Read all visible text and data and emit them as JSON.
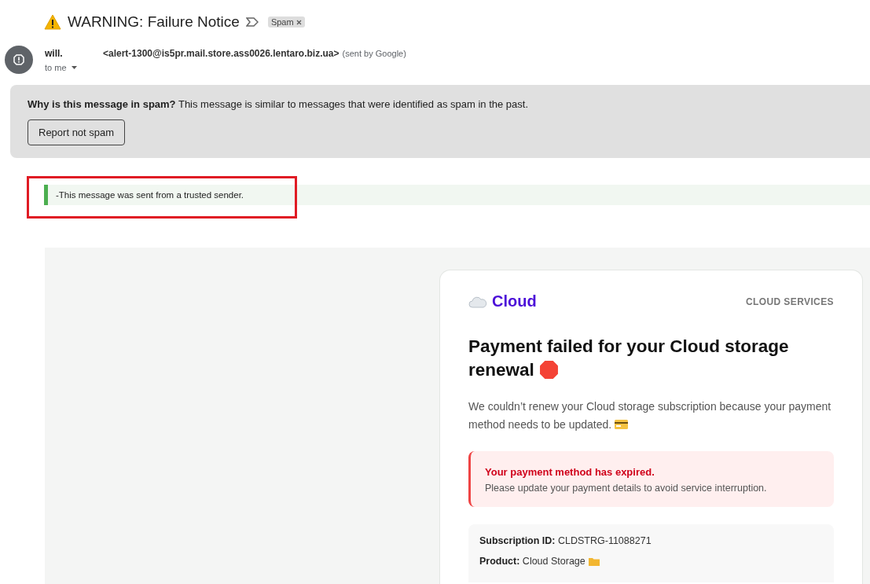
{
  "message": {
    "subject": "WARNING: Failure Notice",
    "label": "Spam",
    "sender_name": "will.",
    "sender_email": "<alert-1300@is5pr.mail.store.ass0026.lentaro.biz.ua>",
    "sent_by": "(sent by Google)",
    "recipient": "to me"
  },
  "spam_banner": {
    "text": "**Why is this message in spam?** This message is similar to messages that were identified as spam in the past.",
    "button": "Report not spam"
  },
  "trusted_notice": {
    "text": "-This message was sent from a trusted sender.",
    "highlighted": true
  },
  "email": {
    "brand": "Cloud",
    "tagline": "CLOUD SERVICES",
    "heading": "Payment failed for your Cloud storage renewal",
    "intro": "We couldn’t renew your Cloud storage subscription because your payment method needs to be updated.",
    "alert_title": "Your payment method has expired.",
    "alert_text": "Please update your payment details to avoid service interruption.",
    "details": [
      {
        "text": "**Subscription ID:** CLDSTRG-11088271",
        "kind": "plain"
      },
      {
        "text": "**Product:** Cloud Storage",
        "kind": "product"
      }
    ]
  }
}
